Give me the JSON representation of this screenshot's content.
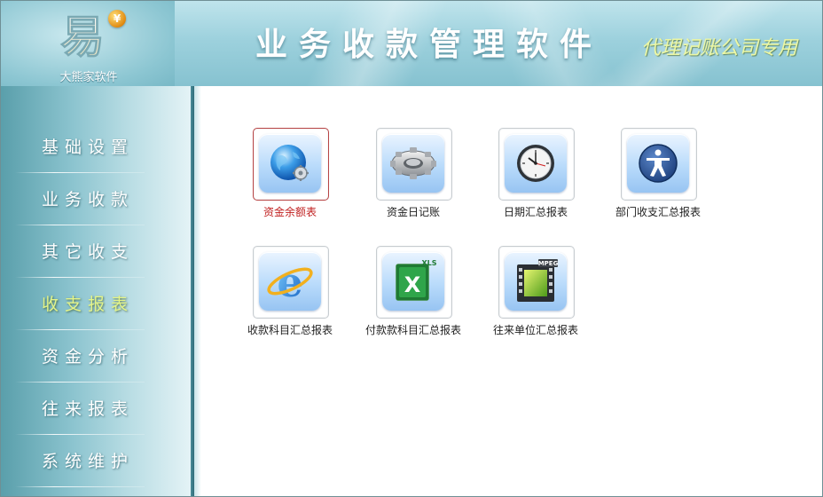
{
  "header": {
    "brand_name": "大熊家软件",
    "logo_glyph": "易",
    "coin_symbol": "¥",
    "app_title": "业务收款管理软件",
    "app_subtitle": "代理记账公司专用"
  },
  "sidebar": {
    "items": [
      {
        "label": "基础设置",
        "active": false
      },
      {
        "label": "业务收款",
        "active": false
      },
      {
        "label": "其它收支",
        "active": false
      },
      {
        "label": "收支报表",
        "active": true
      },
      {
        "label": "资金分析",
        "active": false
      },
      {
        "label": "往来报表",
        "active": false
      },
      {
        "label": "系统维护",
        "active": false
      }
    ]
  },
  "reports": {
    "items": [
      {
        "label": "资金余额表",
        "icon": "globe-gear-icon",
        "selected": true
      },
      {
        "label": "资金日记账",
        "icon": "gear-icon",
        "selected": false
      },
      {
        "label": "日期汇总报表",
        "icon": "clock-icon",
        "selected": false
      },
      {
        "label": "部门收支汇总报表",
        "icon": "person-icon",
        "selected": false
      },
      {
        "label": "收款科目汇总报表",
        "icon": "internet-explorer-icon",
        "selected": false
      },
      {
        "label": "付款款科目汇总报表",
        "icon": "excel-icon",
        "selected": false
      },
      {
        "label": "往来单位汇总报表",
        "icon": "video-icon",
        "selected": false
      }
    ],
    "excel_badge": "XLS",
    "video_badge": "MPEG"
  },
  "colors": {
    "header_bg": "#9dd1dd",
    "active_nav_text": "#e4f48a",
    "selected_label": "#c02020",
    "selected_border": "#b84444"
  }
}
